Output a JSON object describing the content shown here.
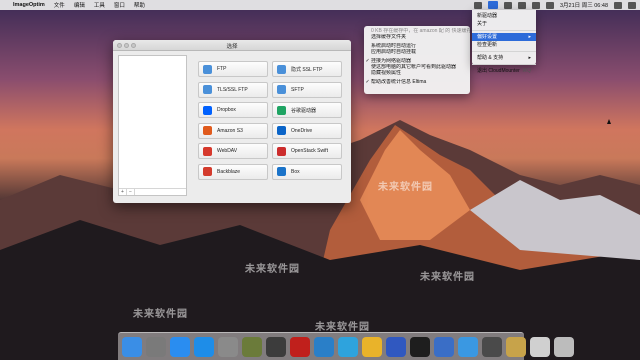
{
  "menubar": {
    "apple": "",
    "app_name": "ImageOptim",
    "menus": [
      "文件",
      "编辑",
      "工具",
      "窗口",
      "帮助"
    ],
    "clock": "3月21日 周三 06:48"
  },
  "window": {
    "title": "选择",
    "sidebar_controls": [
      "+",
      "−"
    ],
    "services": [
      {
        "label": "FTP",
        "color": "#4a90d9"
      },
      {
        "label": "隐式 SSL FTP",
        "color": "#4a90d9"
      },
      {
        "label": "TLS/SSL FTP",
        "color": "#4a90d9"
      },
      {
        "label": "SFTP",
        "color": "#4a90d9"
      },
      {
        "label": "Dropbox",
        "color": "#0061fe"
      },
      {
        "label": "谷歌驱动器",
        "color": "#1fa463"
      },
      {
        "label": "Amazon S3",
        "color": "#e05a1c"
      },
      {
        "label": "OneDrive",
        "color": "#0a64c8"
      },
      {
        "label": "WebDAV",
        "color": "#d6392c"
      },
      {
        "label": "OpenStack Swift",
        "color": "#cc2c2c"
      },
      {
        "label": "Backblaze",
        "color": "#d33b2c"
      },
      {
        "label": "Box",
        "color": "#1a73c9"
      }
    ]
  },
  "dropdown_menu": {
    "items": [
      {
        "label": "0 KB 存在缓存中，在 amazon 配 的 快速缓存中",
        "checked": false,
        "dim": true
      },
      {
        "label": "选择缓存文件夹",
        "checked": false,
        "dim": false
      },
      {
        "label": "",
        "checked": false,
        "dim": false
      },
      {
        "label": "系统启动时自动运行",
        "checked": false,
        "dim": false
      },
      {
        "label": "应用启动时自动挂载",
        "checked": false,
        "dim": false
      },
      {
        "label": "",
        "checked": false,
        "dim": false
      },
      {
        "label": "挂接为网络驱动器",
        "checked": true,
        "dim": false
      },
      {
        "label": "使这部电脑的其它帐户可看到此驱动器",
        "checked": false,
        "dim": false
      },
      {
        "label": "隐藏视频属性",
        "checked": false,
        "dim": false
      },
      {
        "label": "",
        "checked": false,
        "dim": false
      },
      {
        "label": "帮助改善统计信息 Eltima",
        "checked": true,
        "dim": false
      }
    ]
  },
  "status_menu": {
    "items": [
      {
        "label": "新驱动器",
        "highlight": false,
        "arrow": false,
        "shortcut": ""
      },
      {
        "label": "关于",
        "highlight": false,
        "arrow": false,
        "shortcut": ""
      },
      {
        "label": "偏好设置",
        "highlight": true,
        "arrow": true,
        "shortcut": ""
      },
      {
        "label": "检查更新",
        "highlight": false,
        "arrow": false,
        "shortcut": ""
      },
      {
        "label": "帮助 & 支持",
        "highlight": false,
        "arrow": true,
        "shortcut": ""
      },
      {
        "label": "退出 CloudMounter",
        "highlight": false,
        "arrow": false,
        "shortcut": "⌘Q"
      }
    ]
  },
  "watermark": "未来软件园",
  "dock_apps": [
    {
      "name": "finder-icon",
      "color": "#3a8ee6"
    },
    {
      "name": "launchpad-icon",
      "color": "#7a7a7a"
    },
    {
      "name": "safari-icon",
      "color": "#2a8df0"
    },
    {
      "name": "app-store-icon",
      "color": "#1e8de8"
    },
    {
      "name": "system-preferences-icon",
      "color": "#8a8a8a"
    },
    {
      "name": "app-icon-6",
      "color": "#6b7b3a"
    },
    {
      "name": "app-icon-7",
      "color": "#3c3c3c"
    },
    {
      "name": "filezilla-icon",
      "color": "#c0201c"
    },
    {
      "name": "app-icon-9",
      "color": "#2a7fc8"
    },
    {
      "name": "app-icon-10",
      "color": "#2ea3dd"
    },
    {
      "name": "chrome-icon",
      "color": "#e9b32a"
    },
    {
      "name": "app-icon-12",
      "color": "#3058c0"
    },
    {
      "name": "terminal-icon",
      "color": "#1e1e1e"
    },
    {
      "name": "app-icon-14",
      "color": "#3a6ec6"
    },
    {
      "name": "cloudmounter-icon",
      "color": "#3a98e2"
    },
    {
      "name": "app-icon-16",
      "color": "#4a4a4a"
    },
    {
      "name": "app-icon-17",
      "color": "#c7a34a"
    },
    {
      "name": "downloads-icon",
      "color": "#d0d0d0"
    },
    {
      "name": "trash-icon",
      "color": "#bcbcbc"
    }
  ]
}
